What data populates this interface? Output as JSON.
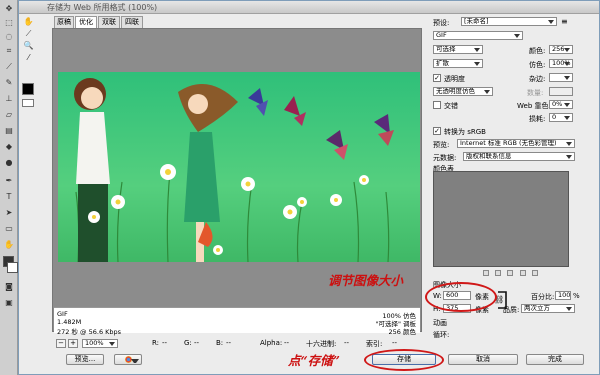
{
  "window": {
    "title": "存储为 Web 所用格式 (100%)"
  },
  "tabs": [
    {
      "label": "原稿"
    },
    {
      "label": "优化"
    },
    {
      "label": "双联"
    },
    {
      "label": "四联"
    }
  ],
  "active_tab": 1,
  "settings": {
    "preset_label": "预设:",
    "preset_value": "[未命名]",
    "format": "GIF",
    "reduction": "可选择",
    "colors_label": "颜色:",
    "colors_value": "256",
    "dither_algo": "扩散",
    "dither_label": "仿色:",
    "dither_value": "100%",
    "transparency_label": "透明度",
    "transparency_checked": true,
    "matte_label": "杂边:",
    "trans_dither": "无透明度仿色",
    "amount_label": "数量:",
    "interlaced_label": "交错",
    "interlaced_checked": false,
    "websnap_label": "Web 靠色:",
    "websnap_value": "0%",
    "lossy_label": "损耗:",
    "lossy_value": "0",
    "srgb_label": "转换为 sRGB",
    "srgb_checked": true,
    "preview_label": "预览:",
    "preview_value": "Internet 标准 RGB (无色彩管理)",
    "metadata_label": "元数据:",
    "metadata_value": "版权和联系信息",
    "color_table_label": "颜色表",
    "image_size_label": "图像大小",
    "width_label": "W:",
    "width_value": "600",
    "height_label": "H:",
    "height_value": "375",
    "pixels_label": "像素",
    "percent_label": "百分比:",
    "percent_value": "100",
    "percent_unit": "%",
    "quality_label": "品质:",
    "quality_value": "两次立方",
    "animation_label": "动画",
    "loop_label": "循环:"
  },
  "image_info": {
    "format": "GIF",
    "size": "1.482M",
    "time": "272 秒 @ 56.6 Kbps",
    "dither_pct": "100% 仿色",
    "palette": "\"可选择\" 调板",
    "colors": "256 颜色"
  },
  "status": {
    "zoom": "100%",
    "r_label": "R:",
    "g_label": "G:",
    "b_label": "B:",
    "alpha_label": "Alpha:",
    "hex_label": "十六进制:",
    "index_label": "索引:",
    "r_value": "--",
    "g_value": "--",
    "b_value": "--",
    "alpha_value": "--",
    "hex_value": "--",
    "index_value": "--"
  },
  "buttons": {
    "preview": "预览...",
    "save": "存储",
    "cancel": "取消",
    "done": "完成"
  },
  "annotations": {
    "resize_note": "调节图像大小",
    "save_note": "点“存储”"
  }
}
